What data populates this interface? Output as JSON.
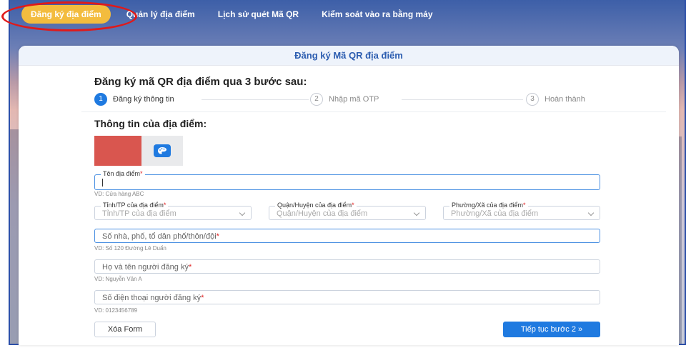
{
  "nav": {
    "items": [
      {
        "label": "Đăng ký địa điểm",
        "active": true
      },
      {
        "label": "Quản lý địa điểm"
      },
      {
        "label": "Lịch sử quét Mã QR"
      },
      {
        "label": "Kiểm soát vào ra bằng máy"
      }
    ]
  },
  "card": {
    "title": "Đăng ký Mã QR địa điểm"
  },
  "steps": {
    "title": "Đăng ký mã QR địa điểm qua 3 bước sau:",
    "items": [
      {
        "num": "1",
        "label": "Đăng ký thông tin"
      },
      {
        "num": "2",
        "label": "Nhập mã OTP"
      },
      {
        "num": "3",
        "label": "Hoàn thành"
      }
    ]
  },
  "section": {
    "title": "Thông tin của địa điểm:"
  },
  "colors": {
    "selected": "#d9564f",
    "accent": "#1f7ae0",
    "nav_active": "#f3bc3e"
  },
  "form": {
    "name": {
      "label": "Tên địa điểm",
      "required": "*",
      "value": "",
      "hint": "VD: Cửa hàng ABC"
    },
    "province": {
      "label": "Tỉnh/TP của địa điểm",
      "required": "*",
      "placeholder": "Tỉnh/TP của địa điểm"
    },
    "district": {
      "label": "Quận/Huyện của địa điểm",
      "required": "*",
      "placeholder": "Quận/Huyện của địa điểm"
    },
    "ward": {
      "label": "Phường/Xã của địa điểm",
      "required": "*",
      "placeholder": "Phường/Xã của địa điểm"
    },
    "address": {
      "placeholder": "Số nhà, phố, tổ dân phố/thôn/đội",
      "required": "*",
      "hint": "VD: Số 120 Đường Lê Duẩn"
    },
    "registrant": {
      "placeholder": "Họ và tên người đăng ký",
      "required": "*",
      "hint": "VD: Nguyễn Văn A"
    },
    "phone": {
      "placeholder": "Số điện thoại người đăng ký",
      "required": "*",
      "hint": "VD: 0123456789"
    }
  },
  "buttons": {
    "reset": "Xóa Form",
    "next": "Tiếp tục bước 2 »"
  }
}
